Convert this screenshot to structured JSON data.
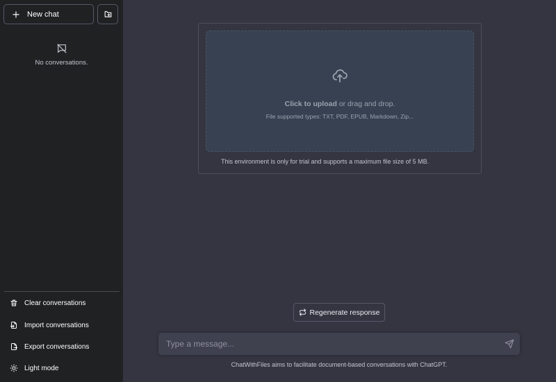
{
  "sidebar": {
    "new_chat_label": "New chat",
    "empty_text": "No conversations.",
    "items": [
      {
        "label": "Clear conversations",
        "icon": "trash-icon"
      },
      {
        "label": "Import conversations",
        "icon": "file-import-icon"
      },
      {
        "label": "Export conversations",
        "icon": "file-export-icon"
      },
      {
        "label": "Light mode",
        "icon": "sun-icon"
      }
    ]
  },
  "upload": {
    "click_label": "Click to upload",
    "drag_label": " or drag and drop.",
    "supported_types": "File supported types: TXT, PDF, EPUB, Markdown, Zip...",
    "env_note": "This environment is only for trial and supports a maximum file size of 5 MB."
  },
  "chat": {
    "regenerate_label": "Regenerate response",
    "input_placeholder": "Type a message...",
    "input_value": "",
    "footer_note": "ChatWithFiles aims to facilitate document-based conversations with ChatGPT."
  },
  "colors": {
    "sidebar_bg": "#202123",
    "main_bg": "#343541",
    "dropzone_bg": "#374151",
    "input_bg": "#40414f"
  }
}
